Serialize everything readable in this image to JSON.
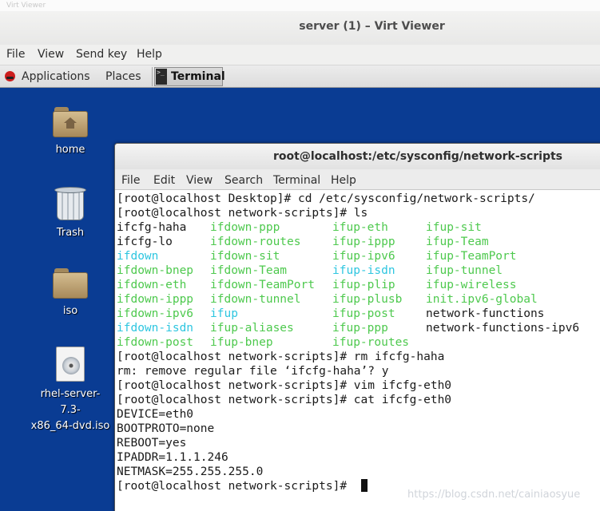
{
  "viewer": {
    "title": "server (1) – Virt Viewer",
    "ghost_text": "Virt Viewer",
    "menu": [
      "File",
      "View",
      "Send key",
      "Help"
    ]
  },
  "guest": {
    "topbar": {
      "applications": "Applications",
      "places": "Places",
      "task": "Terminal"
    },
    "desktop_icons": [
      {
        "label": "home",
        "icon": "home-folder-icon"
      },
      {
        "label": "Trash",
        "icon": "trash-icon"
      },
      {
        "label": "iso",
        "icon": "folder-icon"
      },
      {
        "label": "rhel-server-7.3-x86_64-dvd.iso",
        "line1": "rhel-server-7.3-",
        "line2": "x86_64-dvd.iso",
        "icon": "disc-image-icon"
      }
    ]
  },
  "terminal": {
    "title": "root@localhost:/etc/sysconfig/network-scripts",
    "menu": [
      "File",
      "Edit",
      "View",
      "Search",
      "Terminal",
      "Help"
    ],
    "colors": {
      "green": "#4ec94e",
      "cyan": "#2ec6e0",
      "text": "#1a1a1a"
    },
    "lines_pre": [
      "[root@localhost Desktop]# cd /etc/sysconfig/network-scripts/",
      "[root@localhost network-scripts]# ls"
    ],
    "ls_rows": [
      [
        {
          "t": "ifcfg-haha",
          "c": "text"
        },
        {
          "t": "ifdown-ppp",
          "c": "green"
        },
        {
          "t": "ifup-eth",
          "c": "green"
        },
        {
          "t": "ifup-sit",
          "c": "green"
        }
      ],
      [
        {
          "t": "ifcfg-lo",
          "c": "text"
        },
        {
          "t": "ifdown-routes",
          "c": "green"
        },
        {
          "t": "ifup-ippp",
          "c": "green"
        },
        {
          "t": "ifup-Team",
          "c": "green"
        }
      ],
      [
        {
          "t": "ifdown",
          "c": "cyan"
        },
        {
          "t": "ifdown-sit",
          "c": "green"
        },
        {
          "t": "ifup-ipv6",
          "c": "green"
        },
        {
          "t": "ifup-TeamPort",
          "c": "green"
        }
      ],
      [
        {
          "t": "ifdown-bnep",
          "c": "green"
        },
        {
          "t": "ifdown-Team",
          "c": "green"
        },
        {
          "t": "ifup-isdn",
          "c": "cyan"
        },
        {
          "t": "ifup-tunnel",
          "c": "green"
        }
      ],
      [
        {
          "t": "ifdown-eth",
          "c": "green"
        },
        {
          "t": "ifdown-TeamPort",
          "c": "green"
        },
        {
          "t": "ifup-plip",
          "c": "green"
        },
        {
          "t": "ifup-wireless",
          "c": "green"
        }
      ],
      [
        {
          "t": "ifdown-ippp",
          "c": "green"
        },
        {
          "t": "ifdown-tunnel",
          "c": "green"
        },
        {
          "t": "ifup-plusb",
          "c": "green"
        },
        {
          "t": "init.ipv6-global",
          "c": "green"
        }
      ],
      [
        {
          "t": "ifdown-ipv6",
          "c": "green"
        },
        {
          "t": "ifup",
          "c": "cyan"
        },
        {
          "t": "ifup-post",
          "c": "green"
        },
        {
          "t": "network-functions",
          "c": "text"
        }
      ],
      [
        {
          "t": "ifdown-isdn",
          "c": "cyan"
        },
        {
          "t": "ifup-aliases",
          "c": "green"
        },
        {
          "t": "ifup-ppp",
          "c": "green"
        },
        {
          "t": "network-functions-ipv6",
          "c": "text"
        }
      ],
      [
        {
          "t": "ifdown-post",
          "c": "green"
        },
        {
          "t": "ifup-bnep",
          "c": "green"
        },
        {
          "t": "ifup-routes",
          "c": "green"
        },
        {
          "t": "",
          "c": "text"
        }
      ]
    ],
    "lines_post": [
      "[root@localhost network-scripts]# rm ifcfg-haha",
      "rm: remove regular file ‘ifcfg-haha’? y",
      "[root@localhost network-scripts]# vim ifcfg-eth0",
      "[root@localhost network-scripts]# cat ifcfg-eth0",
      "DEVICE=eth0",
      "BOOTPROTO=none",
      "REBOOT=yes",
      "IPADDR=1.1.1.246",
      "NETMASK=255.255.255.0",
      "[root@localhost network-scripts]# "
    ]
  },
  "watermark": "https://blog.csdn.net/cainiaosyue"
}
